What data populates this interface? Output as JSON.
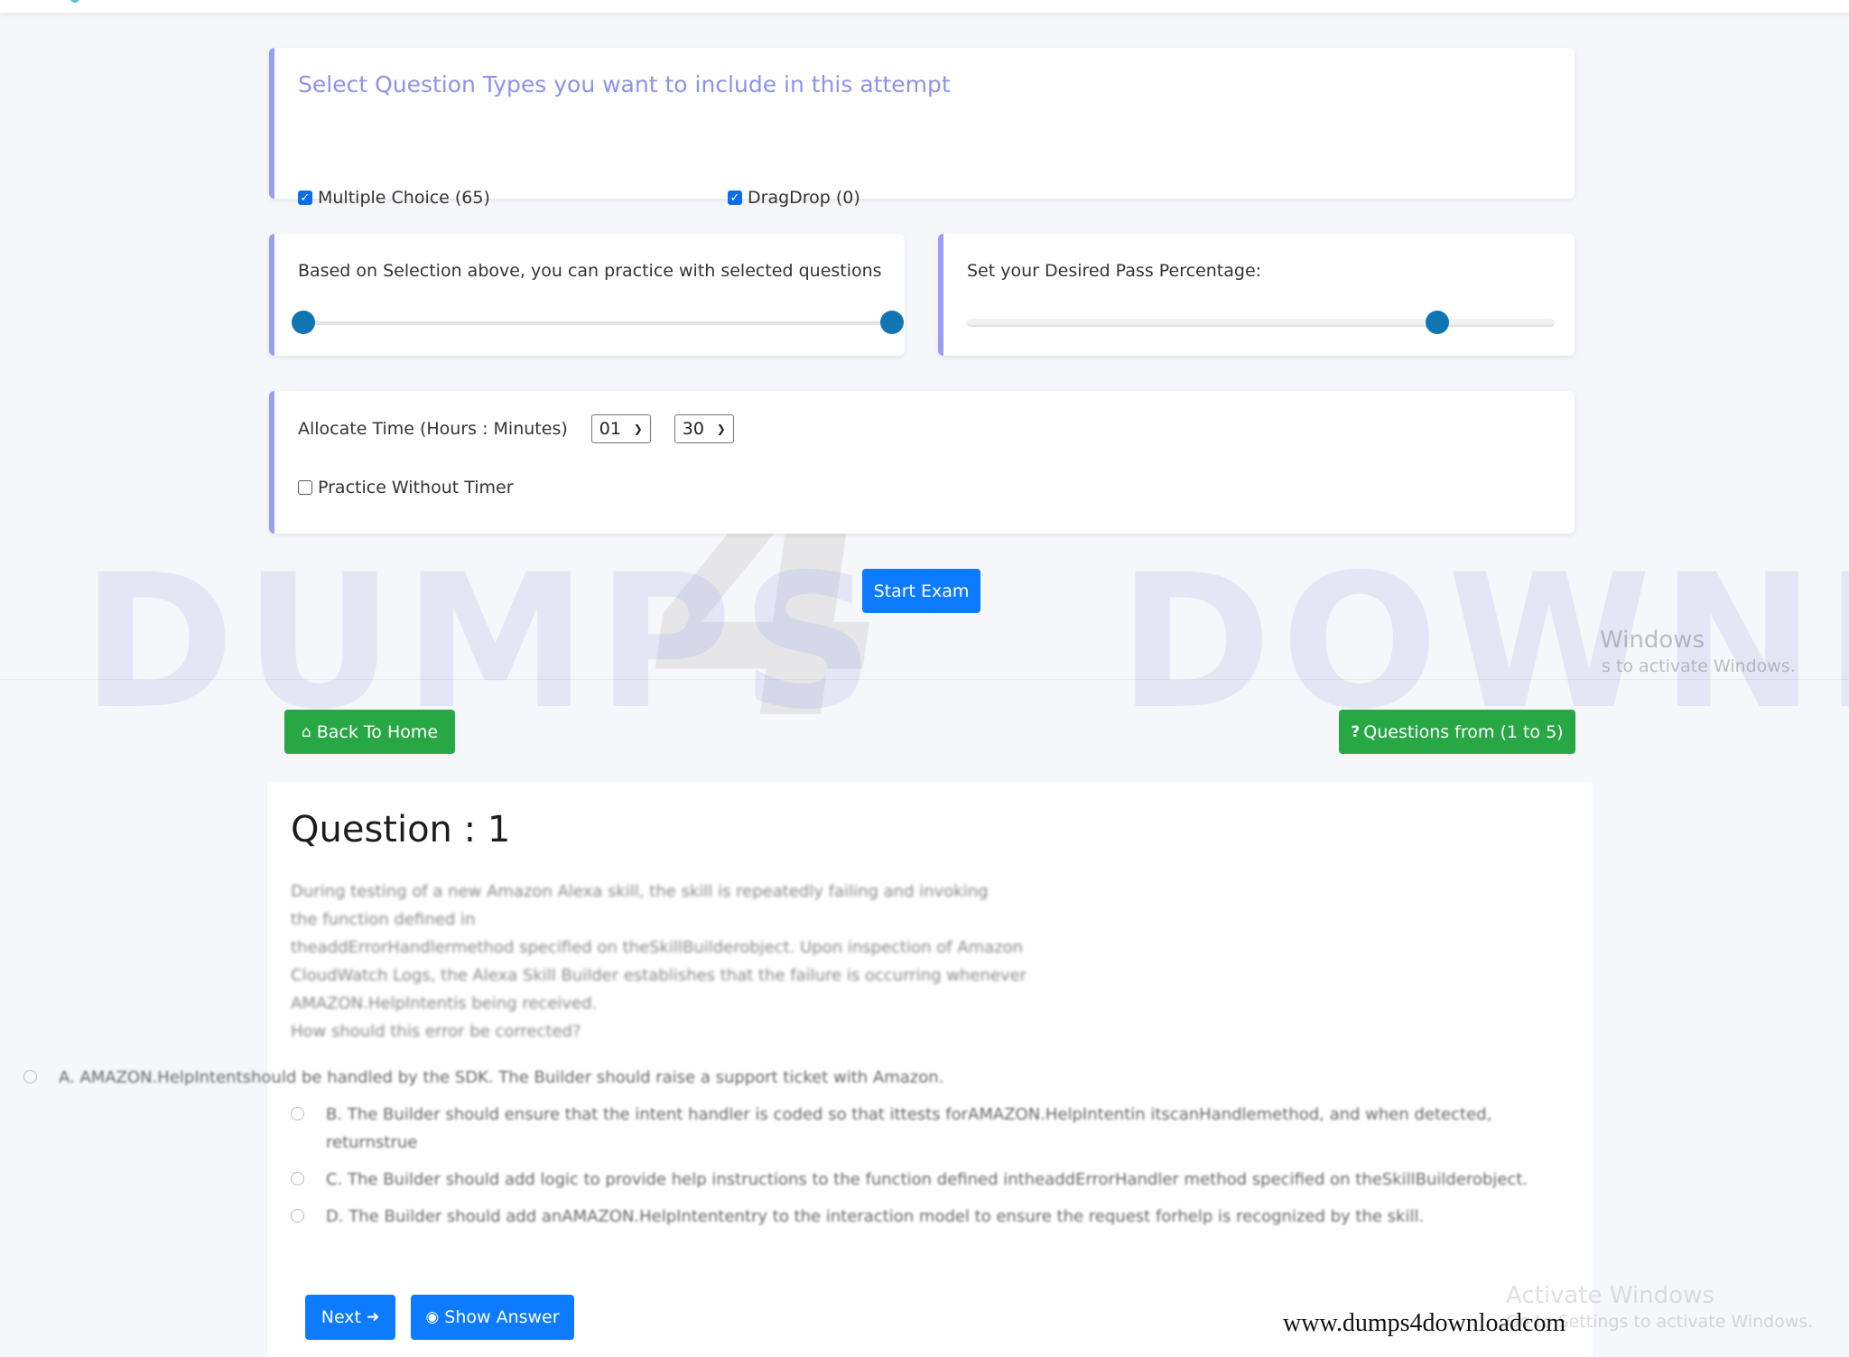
{
  "question_types": {
    "title": "Select Question Types you want to include in this attempt",
    "options": [
      {
        "label": "Multiple Choice (65)",
        "checked": true
      },
      {
        "label": "DragDrop (0)",
        "checked": true
      }
    ]
  },
  "range": {
    "label": "Based on Selection above, you can practice with selected questions",
    "min_fraction": 0,
    "max_fraction": 1
  },
  "pass": {
    "label": "Set your Desired Pass Percentage:",
    "value_percent": 80
  },
  "time": {
    "label": "Allocate Time (Hours : Minutes)",
    "hours": "01",
    "minutes": "30",
    "no_timer_label": "Practice Without Timer",
    "no_timer_checked": false
  },
  "buttons": {
    "start_exam": "Start Exam",
    "back_home": "Back To Home",
    "questions_range": "Questions from (1 to 5)",
    "next": "Next",
    "show_answer": "Show Answer"
  },
  "icons": {
    "home": "home-icon",
    "question": "question-icon",
    "arrow_right": "arrow-right-icon",
    "eye": "eye-icon"
  },
  "question": {
    "title": "Question : 1",
    "text_lines": [
      "During testing of a new Amazon Alexa skill, the skill is repeatedly failing and invoking",
      "the function defined in",
      "theaddErrorHandlermethod specified on theSkillBuilderobject. Upon inspection of Amazon",
      "CloudWatch Logs, the Alexa Skill Builder establishes that the failure is occurring whenever",
      "AMAZON.HelpIntentis being received.",
      "How should this error be corrected?"
    ],
    "options": [
      "A. AMAZON.HelpIntentshould be handled by the SDK. The Builder should raise a support ticket with Amazon.",
      "B. The Builder should ensure that the intent handler is coded so that ittests forAMAZON.HelpIntentin itscanHandlemethod, and when detected, returnstrue",
      "C. The Builder should add logic to provide help instructions to the function defined intheaddErrorHandler method specified on theSkillBuilderobject.",
      "D. The Builder should add anAMAZON.HelpIntententry to the interaction model to ensure the request forhelp is recognized by the skill."
    ]
  },
  "watermarks": {
    "brand": "DUMPS",
    "brand_number": "4",
    "brand_tail": "DOWNLOAD",
    "site": "www.dumps4downloadcom",
    "activate_title": "Activate Windows",
    "activate_partial_title": "Windows",
    "activate_sub": "Go to Settings to activate Windows.",
    "activate_partial_sub": "s to activate Windows."
  },
  "colors": {
    "accent_blue": "#0d7bff",
    "success_green": "#28a745",
    "card_border": "#9a9cf5",
    "title_purple": "#8f92ea",
    "slider_thumb": "#0f76b3"
  }
}
